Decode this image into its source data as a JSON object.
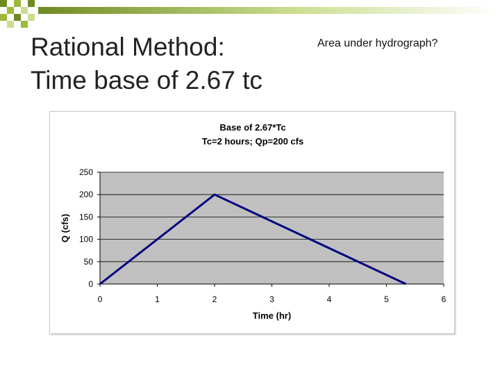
{
  "slide": {
    "title_lines": [
      "Rational Method:",
      "Time base of 2.67 tc"
    ],
    "note": "Area under hydrograph?",
    "accent_colors": [
      "#6e8b22",
      "#9bbb3b",
      "#c9dd8e"
    ]
  },
  "chart_data": {
    "type": "line",
    "title_lines": [
      "Base of 2.67*Tc",
      "Tc=2 hours; Qp=200 cfs"
    ],
    "xlabel": "Time (hr)",
    "ylabel": "Q (cfs)",
    "xlim": [
      0,
      6
    ],
    "ylim": [
      0,
      250
    ],
    "xticks": [
      0,
      1,
      2,
      3,
      4,
      5,
      6
    ],
    "yticks": [
      0,
      50,
      100,
      150,
      200,
      250
    ],
    "grid": "horizontal",
    "plot_background": "#c0c0c0",
    "series": [
      {
        "x": [
          0,
          2,
          5.34
        ],
        "y": [
          0,
          200,
          0
        ],
        "color": "#000080"
      }
    ]
  }
}
